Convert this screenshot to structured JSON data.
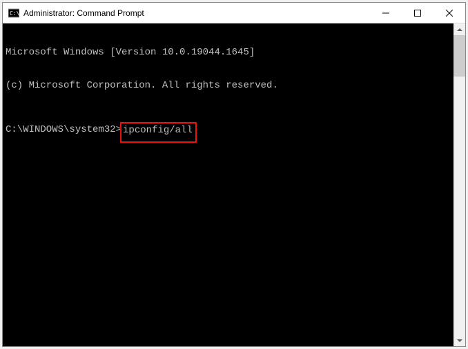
{
  "window": {
    "title": "Administrator: Command Prompt"
  },
  "terminal": {
    "line1": "Microsoft Windows [Version 10.0.19044.1645]",
    "line2": "(c) Microsoft Corporation. All rights reserved.",
    "prompt": "C:\\WINDOWS\\system32>",
    "command": "ipconfig/all"
  }
}
